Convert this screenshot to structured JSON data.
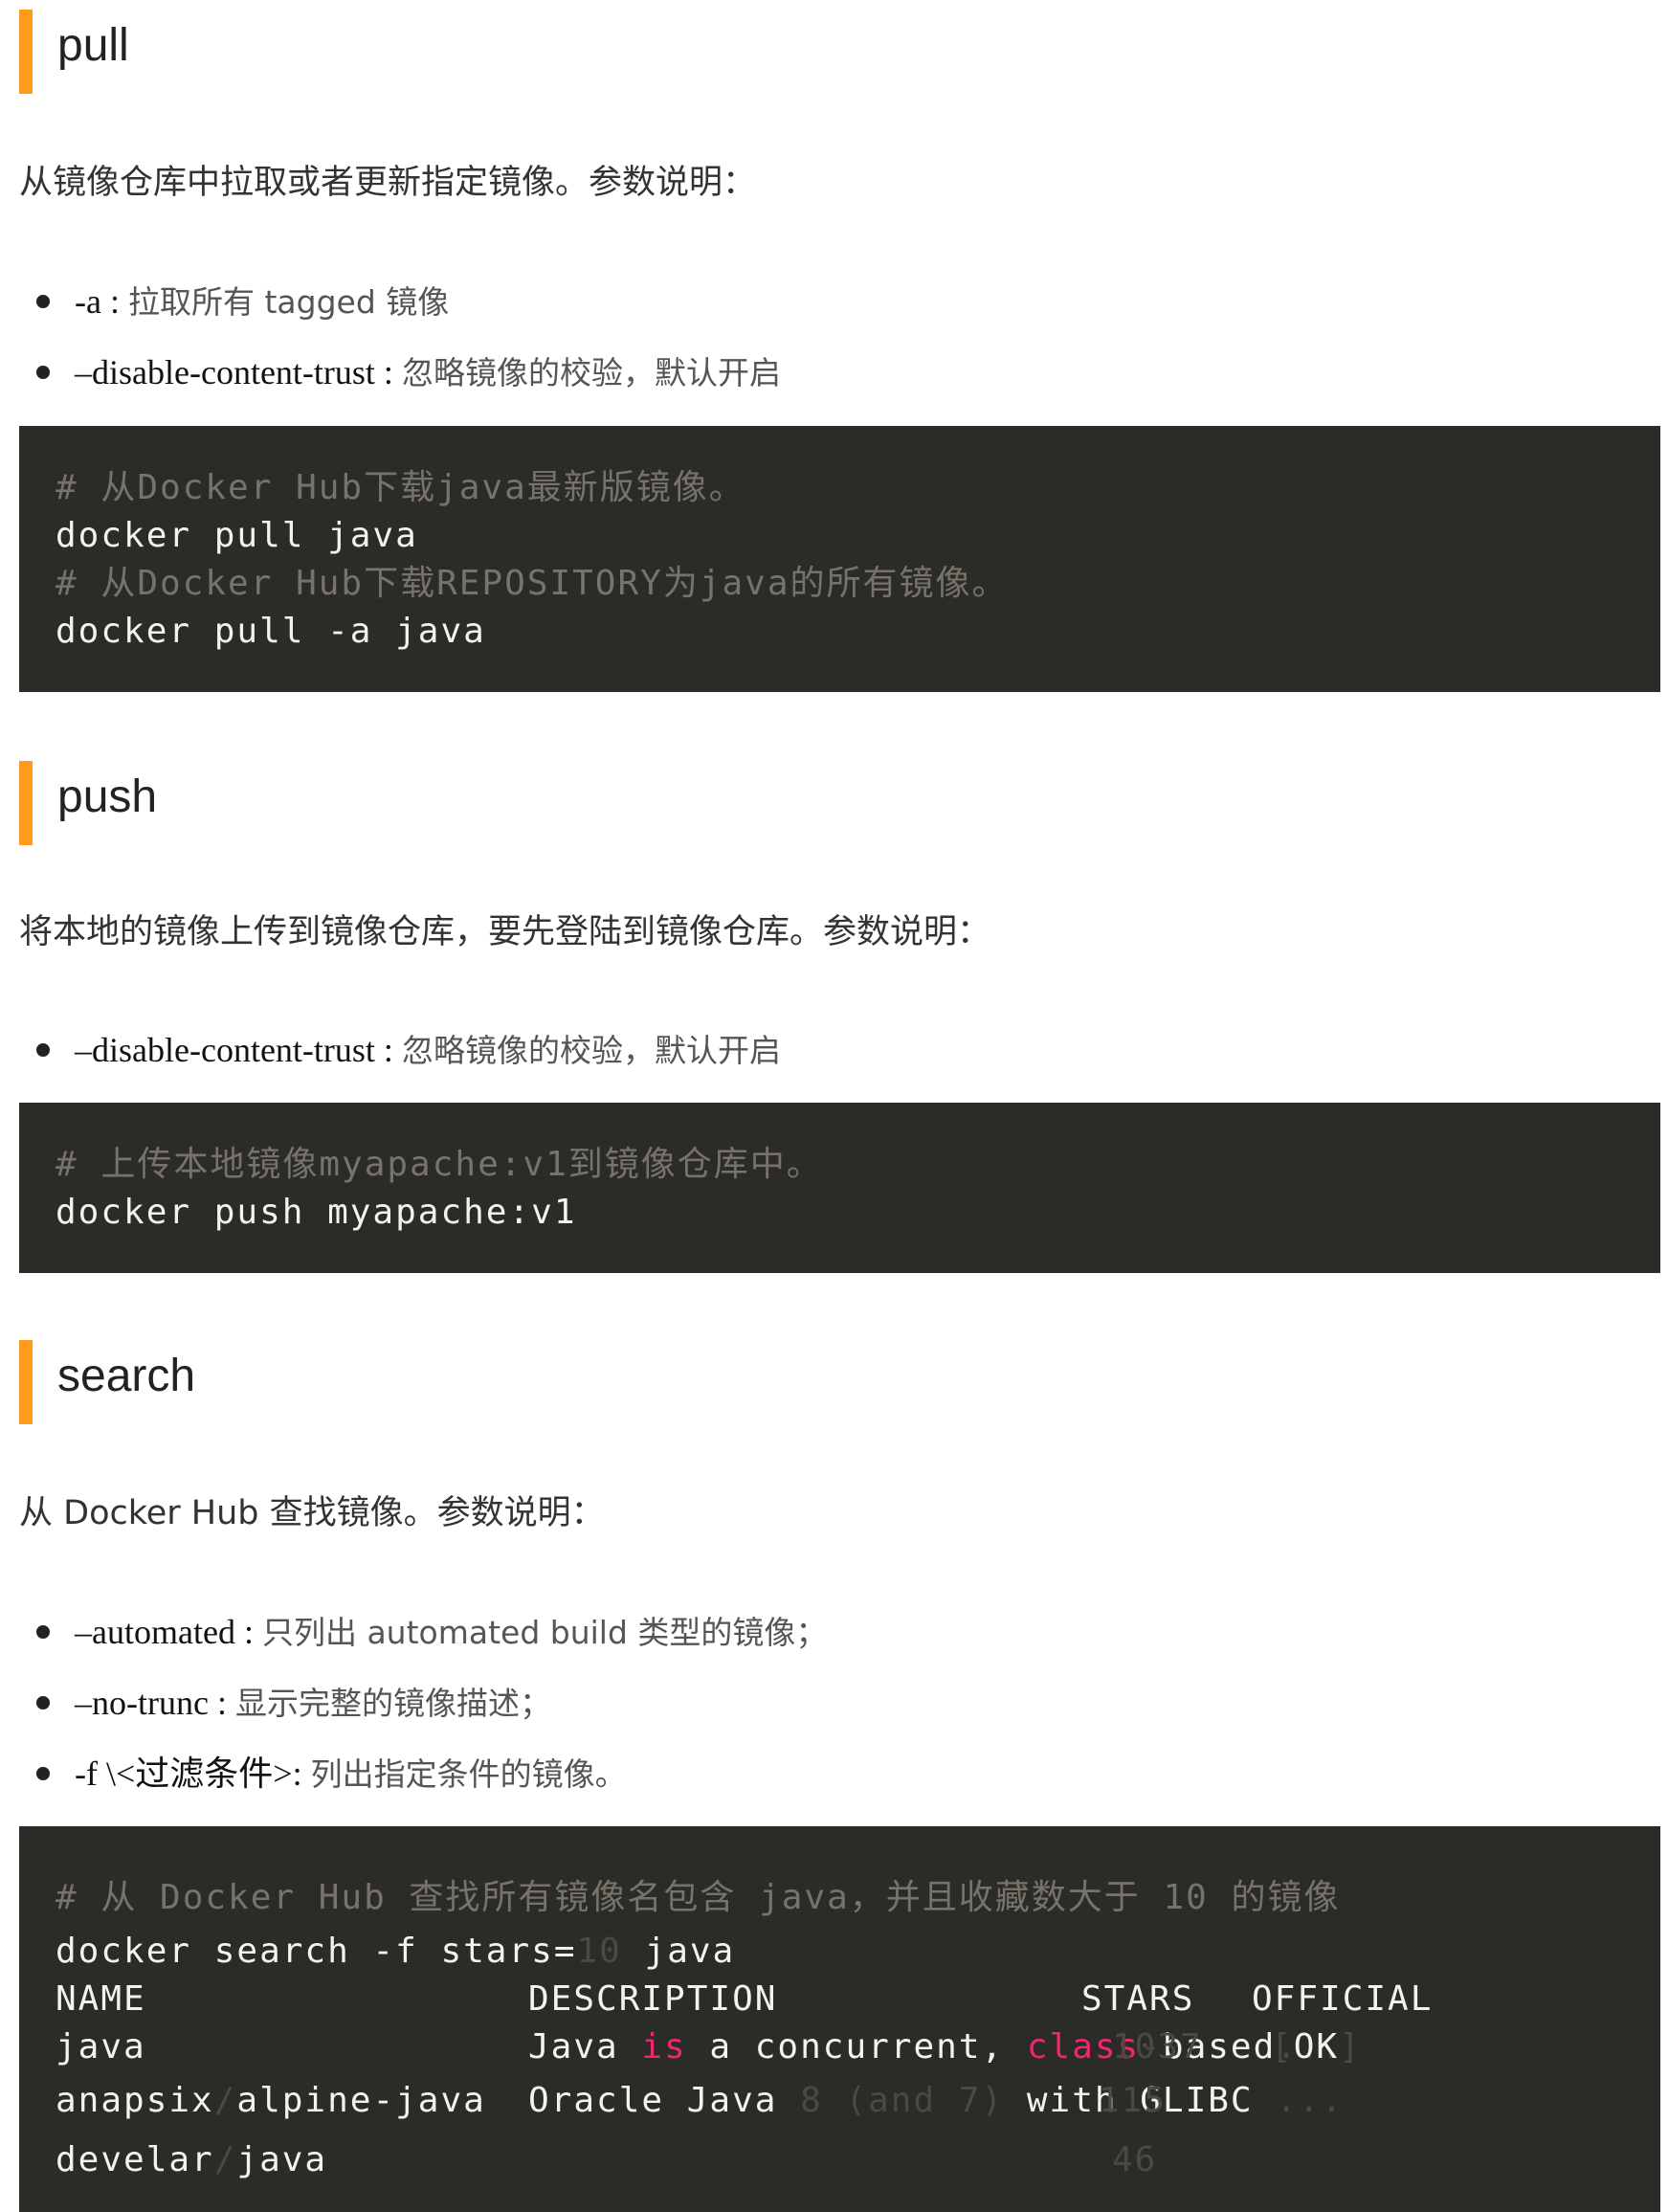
{
  "pull": {
    "heading": "pull",
    "intro": "从镜像仓库中拉取或者更新指定镜像。参数说明：",
    "params": [
      {
        "name": "-a",
        "sep": " : ",
        "desc": "拉取所有 tagged 镜像"
      },
      {
        "name": "–disable-content-trust",
        "sep": " : ",
        "desc": "忽略镜像的校验，默认开启"
      }
    ],
    "code": [
      {
        "type": "comment",
        "text": "# 从Docker Hub下载java最新版镜像。"
      },
      {
        "type": "cmd",
        "text": "docker pull java"
      },
      {
        "type": "comment",
        "text": "# 从Docker Hub下载REPOSITORY为java的所有镜像。"
      },
      {
        "type": "cmd",
        "text": "docker pull -a java"
      }
    ]
  },
  "push": {
    "heading": "push",
    "intro": "将本地的镜像上传到镜像仓库，要先登陆到镜像仓库。参数说明：",
    "params": [
      {
        "name": "–disable-content-trust",
        "sep": " : ",
        "desc": "忽略镜像的校验，默认开启"
      }
    ],
    "code": [
      {
        "type": "comment",
        "text": "# 上传本地镜像myapache:v1到镜像仓库中。"
      },
      {
        "type": "cmd",
        "text": "docker push myapache:v1"
      }
    ]
  },
  "search": {
    "heading": "search",
    "intro": "从 Docker Hub 查找镜像。参数说明：",
    "params": [
      {
        "name": "–automated",
        "sep": " : ",
        "desc": "只列出 automated build 类型的镜像；"
      },
      {
        "name": "–no-trunc",
        "sep": " : ",
        "desc": "显示完整的镜像描述；"
      },
      {
        "name": "-f \\<过滤条件>",
        "sep": ": ",
        "desc": "列出指定条件的镜像。"
      }
    ],
    "code_comment": "# 从 Docker Hub 查找所有镜像名包含 java，并且收藏数大于 10 的镜像",
    "code_cmd": {
      "pre": "docker search -f stars=",
      "num": "10",
      "post": " java"
    },
    "table_header": {
      "name": "NAME",
      "description": "DESCRIPTION",
      "stars": "STARS",
      "official": "OFFICIAL"
    },
    "rows": [
      {
        "name_a": "java",
        "name_sep": "",
        "name_b": "",
        "desc_parts": [
          "Java ",
          "is",
          " a concurrent, ",
          "class",
          "-",
          "based",
          "..."
        ],
        "stars": "1037",
        "official_open": "[",
        "official": "OK",
        "official_close": "]"
      },
      {
        "name_a": "anapsix",
        "name_sep": "/",
        "name_b": "alpine-java",
        "desc_parts": [
          "Oracle Java ",
          "8 (and 7)",
          " with GLIBC ",
          "..."
        ],
        "stars": "115",
        "official_open": "",
        "official": "",
        "official_close": ""
      },
      {
        "name_a": "develar",
        "name_sep": "/",
        "name_b": "java",
        "desc_parts": [],
        "stars": "46",
        "official_open": "",
        "official": "",
        "official_close": ""
      }
    ]
  }
}
